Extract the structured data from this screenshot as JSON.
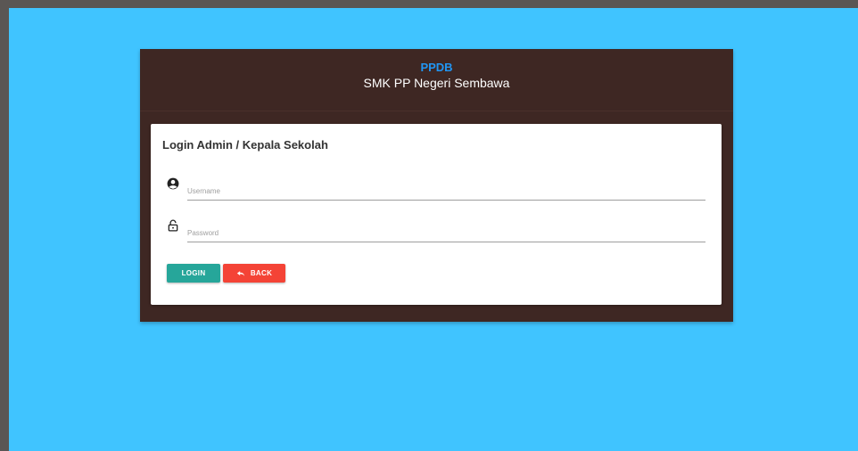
{
  "header": {
    "brand": "PPDB",
    "school": "SMK PP Negeri Sembawa"
  },
  "login_card": {
    "title": "Login Admin / Kepala Sekolah",
    "username": {
      "placeholder": "Username",
      "value": "",
      "icon": "user-circle-icon"
    },
    "password": {
      "placeholder": "Password",
      "value": "",
      "icon": "lock-icon"
    },
    "login_label": "LOGIN",
    "back_label": "BACK",
    "back_icon": "undo-icon"
  },
  "colors": {
    "background": "#40c4ff",
    "panel": "#3e2723",
    "brand": "#2196f3",
    "login_button": "#26a69a",
    "back_button": "#f44336"
  }
}
